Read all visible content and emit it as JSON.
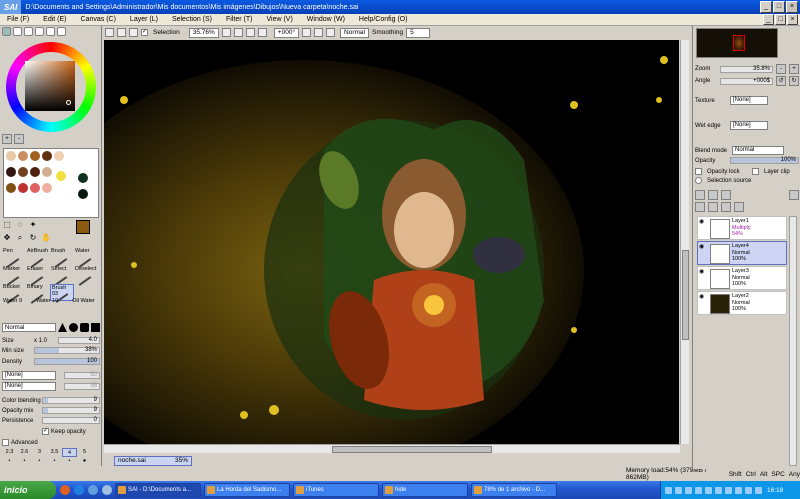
{
  "window": {
    "app_logo": "SAI",
    "title": "D:\\Documents and Settings\\Administrador\\Mis documentos\\Mis imágenes\\Dibujos\\Nueva carpeta\\noche.sai",
    "minimize": "_",
    "maximize": "□",
    "close": "×"
  },
  "menu": [
    "File (F)",
    "Edit (E)",
    "Canvas (C)",
    "Layer (L)",
    "Selection (S)",
    "Filter (T)",
    "View (V)",
    "Window (W)",
    "Help/Config (O)"
  ],
  "toolbar": {
    "selection_label": "Selection",
    "zoom": "35.76%",
    "angle": "+000°",
    "mode": "Normal",
    "smoothing_label": "Smoothing",
    "smoothing_value": "5"
  },
  "tools": {
    "brushes": [
      {
        "label": "Pen",
        "num": ""
      },
      {
        "label": "AirBrush",
        "num": ""
      },
      {
        "label": "Brush",
        "num": ""
      },
      {
        "label": "Water",
        "num": ""
      },
      {
        "label": "Marker",
        "num": ""
      },
      {
        "label": "Eraser",
        "num": ""
      },
      {
        "label": "Select",
        "num": ""
      },
      {
        "label": "Deselect",
        "num": ""
      },
      {
        "label": "Bucket",
        "num": ""
      },
      {
        "label": "Binary",
        "num": ""
      },
      {
        "label": "Brush 03",
        "num": ""
      },
      {
        "label": "",
        "num": ""
      }
    ],
    "sub": [
      "Water 9",
      "Water 10",
      "Oil Water"
    ],
    "mode": "Normal",
    "size_label": "Size",
    "size_mult": "x 1.0",
    "size_value": "4.0",
    "minsize_label": "Min size",
    "minsize_value": "38%",
    "density_label": "Density",
    "density_value": "100",
    "tex1": "[None]",
    "tex2": "[None]",
    "tex1_val": "50",
    "tex2_val": "95",
    "colorblend_label": "Color blending",
    "colorblend_value": "9",
    "opmix_label": "Opacity mix",
    "opmix_value": "9",
    "persist_label": "Persistence",
    "persist_value": "0",
    "keep_opacity": "Keep opacity",
    "advanced": "Advanced",
    "sizes": [
      "2.3",
      "2.6",
      "3",
      "3.5",
      "4",
      "5"
    ],
    "fill_pct": {
      "minsize": 38,
      "density": 100,
      "colorblend": 9,
      "opmix": 9
    }
  },
  "right": {
    "zoom_label": "Zoom",
    "zoom_value": "35.8%",
    "angle_label": "Angle",
    "angle_value": "+000$",
    "texture_label": "Texture",
    "texture_value": "[None]",
    "wetedge_label": "Wet edge",
    "wetedge_value": "[None]",
    "blend_label": "Blend mode",
    "blend_value": "Normal",
    "opacity_label": "Opacity",
    "opacity_value": "100%",
    "opacity_lock": "Opacity lock",
    "layer_clip": "Layer clip",
    "selection_source": "Selection source"
  },
  "layers": [
    {
      "name": "Layer1",
      "mode": "Multiply",
      "opacity": "54%",
      "selected": false
    },
    {
      "name": "Layer4",
      "mode": "Normal",
      "opacity": "100%",
      "selected": true
    },
    {
      "name": "Layer3",
      "mode": "Normal",
      "opacity": "100%",
      "selected": false
    },
    {
      "name": "Layer2",
      "mode": "Normal",
      "opacity": "100%",
      "selected": false
    }
  ],
  "document": {
    "name": "noche.sai",
    "zoom": "35%"
  },
  "status": {
    "memory": "Memory load:54% (379MB / 862MB)",
    "keys": [
      "Shift",
      "Ctrl",
      "Alt",
      "SPC",
      "Any"
    ]
  },
  "taskbar": {
    "start": "inicio",
    "tasks": [
      "SAI - D:\\Documents a...",
      "La Horda del Sadismo...",
      "iTunes",
      "hide",
      "78% de 1 archivo - D..."
    ],
    "clock": "16:18"
  },
  "colors": {
    "title": "#0a50d8",
    "selected_layer": "#cdd4f4",
    "canvas_glow": "#7a6010"
  }
}
